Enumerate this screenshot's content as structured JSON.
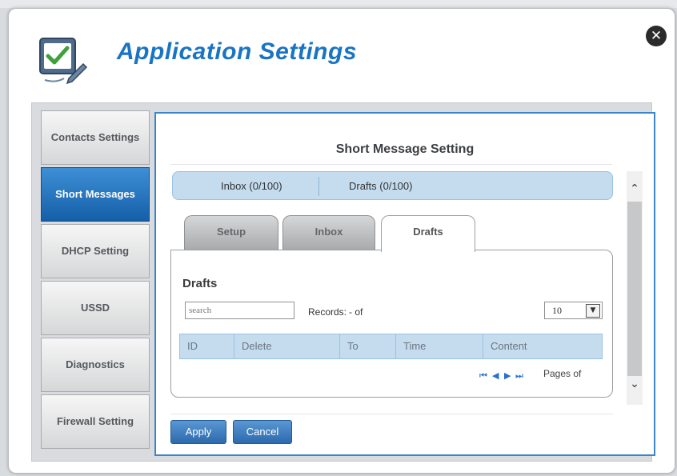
{
  "app": {
    "title": "Application Settings",
    "close_icon": "close-icon",
    "app_icon": "settings-checklist-icon"
  },
  "sidebar": {
    "items": [
      {
        "label": "Contacts Settings",
        "active": false
      },
      {
        "label": "Short Messages",
        "active": true
      },
      {
        "label": "DHCP Setting",
        "active": false
      },
      {
        "label": "USSD",
        "active": false
      },
      {
        "label": "Diagnostics",
        "active": false
      },
      {
        "label": "Firewall Setting",
        "active": false
      }
    ]
  },
  "panel": {
    "title": "Short Message Setting",
    "inbox_count": "Inbox (0/100)",
    "drafts_count": "Drafts (0/100)",
    "tabs": [
      {
        "label": "Setup",
        "active": false
      },
      {
        "label": "Inbox",
        "active": false
      },
      {
        "label": "Drafts",
        "active": true
      }
    ],
    "drafts": {
      "heading": "Drafts",
      "search_placeholder": "search",
      "records_label": "Records:",
      "records_value": "- of",
      "page_size": "10",
      "columns": [
        "ID",
        "Delete",
        "To",
        "Time",
        "Content"
      ],
      "pager_icons": [
        "first-page-icon",
        "prev-page-icon",
        "next-page-icon",
        "last-page-icon"
      ],
      "pages_label": "Pages of"
    },
    "apply_label": "Apply",
    "cancel_label": "Cancel"
  },
  "colors": {
    "accent": "#1a74c4",
    "active_tab_blue": "#155fa8",
    "grid_header": "#c5dcef"
  }
}
